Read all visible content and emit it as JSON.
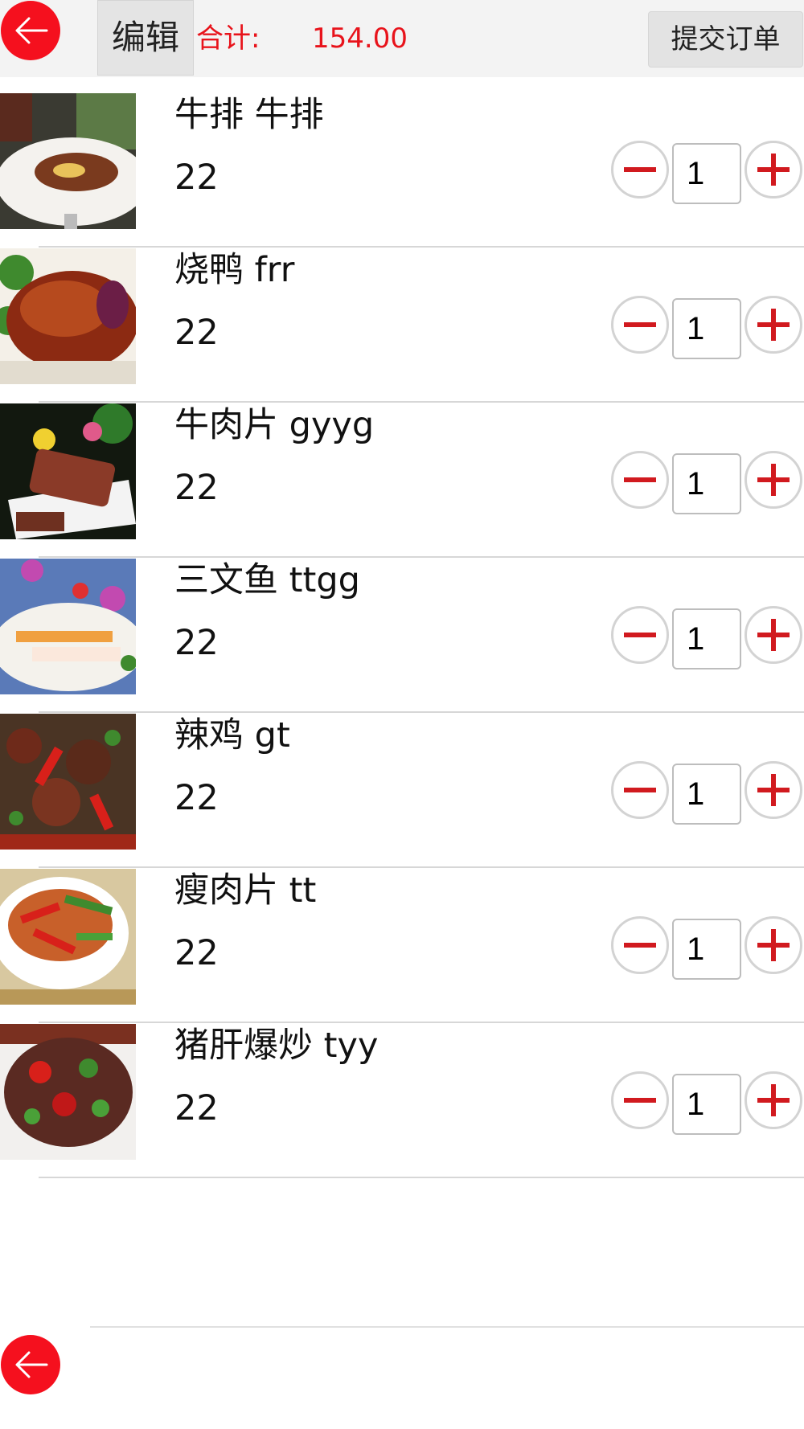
{
  "header": {
    "back_icon": "arrow-left-icon",
    "edit_label": "编辑",
    "total_label": "合计:",
    "total_value": "154.00",
    "submit_label": "提交订单"
  },
  "items": [
    {
      "name": "牛排 牛排",
      "price": "22",
      "quantity": "1"
    },
    {
      "name": "烧鸭 frr",
      "price": "22",
      "quantity": "1"
    },
    {
      "name": "牛肉片 gyyg",
      "price": "22",
      "quantity": "1"
    },
    {
      "name": "三文鱼 ttgg",
      "price": "22",
      "quantity": "1"
    },
    {
      "name": "辣鸡 gt",
      "price": "22",
      "quantity": "1"
    },
    {
      "name": "瘦肉片 tt",
      "price": "22",
      "quantity": "1"
    },
    {
      "name": "猪肝爆炒 tyy",
      "price": "22",
      "quantity": "1"
    }
  ],
  "footer": {
    "back_icon": "arrow-left-icon"
  },
  "colors": {
    "accent": "#e8131b",
    "back_button": "#f5101e"
  }
}
